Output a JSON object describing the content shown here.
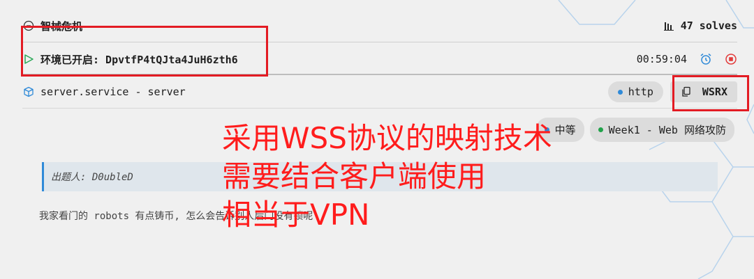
{
  "challenge": {
    "title": "智械危机",
    "solves": "47 solves"
  },
  "env": {
    "status": "环境已开启: DpvtfP4tQJta4JuH6zth6",
    "timer": "00:59:04"
  },
  "service": {
    "name": "server.service - server",
    "protocol": "http",
    "wsrx_label": "WSRX"
  },
  "tags": {
    "difficulty": "中等",
    "category": "Week1 - Web 网络攻防"
  },
  "author": "出题人: D0ubleD",
  "description": "我家看门的 robots 有点铸币, 怎么会告诉别人后门没有锁呢",
  "annotation": {
    "line1": "采用WSS协议的映射技术",
    "line2": "需要结合客户端使用",
    "line3": "相当于VPN"
  },
  "colors": {
    "accent_blue": "#2f8ad8",
    "play_green": "#2aa857",
    "stop_red": "#e23b3b",
    "annotation_red": "#ff1c1c",
    "dot_green": "#21a24a"
  },
  "icons": {
    "title": "circle-minus-icon",
    "solves": "bar-chart-icon",
    "env": "play-icon",
    "alarm": "alarm-clock-icon",
    "stop": "stop-icon",
    "service": "box-icon",
    "copy": "copy-icon"
  }
}
